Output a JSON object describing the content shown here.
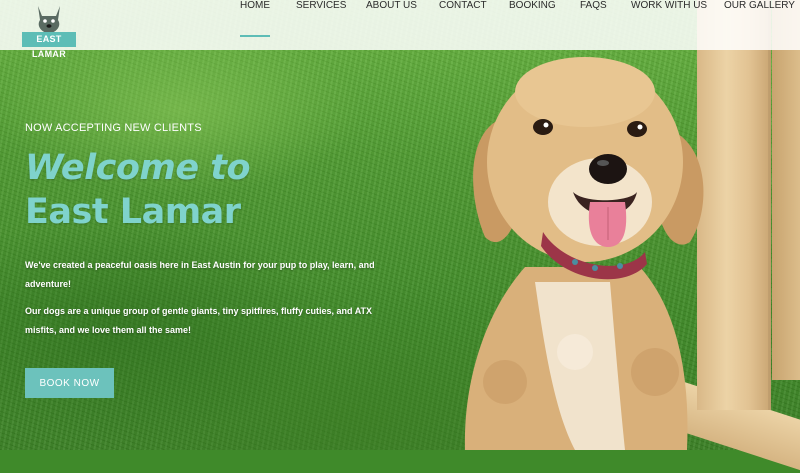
{
  "brand": {
    "logo_text": "EAST LAMAR"
  },
  "nav": {
    "items": [
      {
        "label": "HOME",
        "active": true
      },
      {
        "label": "SERVICES",
        "active": false
      },
      {
        "label": "ABOUT US",
        "active": false
      },
      {
        "label": "CONTACT",
        "active": false
      },
      {
        "label": "BOOKING",
        "active": false
      },
      {
        "label": "FAQS",
        "active": false
      },
      {
        "label": "WORK WITH US",
        "active": false
      },
      {
        "label": "OUR GALLERY",
        "active": false
      }
    ]
  },
  "hero": {
    "eyebrow": "NOW ACCEPTING NEW CLIENTS",
    "headline_line1": "Welcome to",
    "headline_line2": "East Lamar",
    "paragraph1": "We've created a peaceful oasis here in East Austin for your pup to play, learn, and adventure!",
    "paragraph2": "Our dogs are a unique group of gentle giants, tiny spitfires, fluffy cuties, and ATX misfits, and we love them all the same!",
    "cta_label": "BOOK NOW"
  },
  "colors": {
    "accent": "#5dbdb6",
    "headline": "#7fd3cc",
    "header_bg": "#ffffff",
    "nav_text": "#2b2b2b"
  }
}
